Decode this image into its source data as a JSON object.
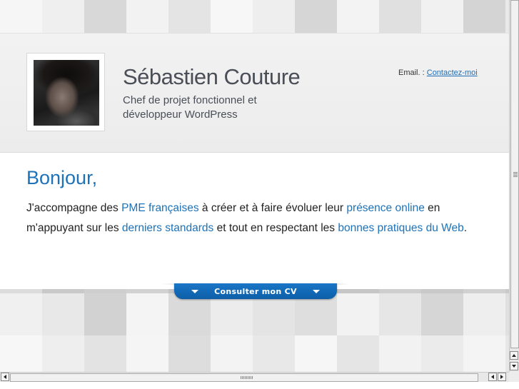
{
  "header": {
    "name": "Sébastien Couture",
    "job_title": "Chef de projet fonctionnel et développeur WordPress",
    "email_label": "Email. :",
    "email_link": "Contactez-moi"
  },
  "main": {
    "greeting": "Bonjour,",
    "intro": {
      "t1": "J'accompagne des ",
      "l1": "PME françaises",
      "t2": " à créer et à faire évoluer leur ",
      "l2": "présence online",
      "t3": " en m'appuyant sur les ",
      "l3": "derniers standards",
      "t4": " et tout en respectant les ",
      "l4": "bonnes pratiques du Web",
      "t5": "."
    }
  },
  "cv_tab": {
    "label": "Consulter mon CV"
  },
  "colors": {
    "accent": "#1d72b8",
    "cv_tab": "#1470bd",
    "heading_text": "#4a4e57"
  },
  "icons": {
    "cv_left": "chevron-down-icon",
    "cv_right": "chevron-down-icon"
  }
}
